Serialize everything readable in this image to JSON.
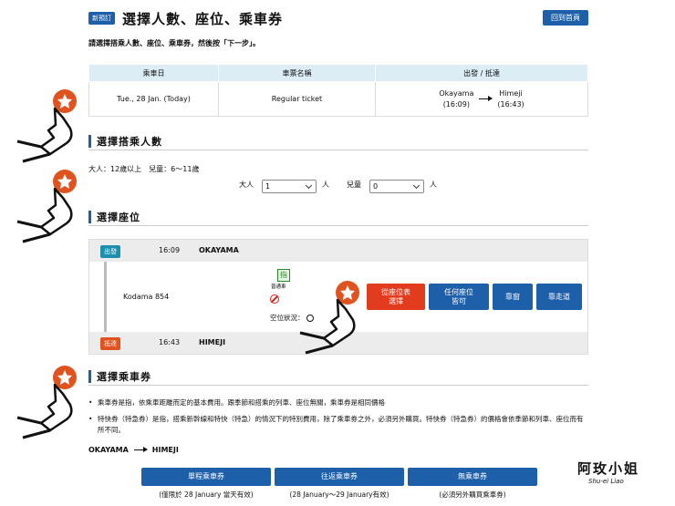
{
  "header": {
    "badge": "新預訂",
    "title": "選擇人數、座位、乘車券",
    "home_button": "回到首頁"
  },
  "instruction": "請選擇搭乘人數、座位、乘車券，然後按「下一步」。",
  "trip_table": {
    "headers": [
      "乘車日",
      "車票名稱",
      "出發 / 抵達"
    ],
    "date": "Tue., 28 Jan. (Today)",
    "ticket_name": "Regular ticket",
    "from_station": "Okayama",
    "from_time": "(16:09)",
    "to_station": "Himeji",
    "to_time": "(16:43)"
  },
  "passengers": {
    "section_title": "選擇搭乘人數",
    "note": "大人：12歲以上　兒童：6～11歲",
    "adult_label": "大人",
    "adult_value": "1",
    "child_label": "兒童",
    "child_value": "0",
    "unit": "人"
  },
  "seats": {
    "section_title": "選擇座位",
    "dep_tag": "出發",
    "dep_time": "16:09",
    "dep_station": "OKAYAMA",
    "train": "Kodama 854",
    "reserved_icon": "指",
    "car_type": "普通車",
    "vacancy_label": "空位狀況：",
    "arr_tag": "抵達",
    "arr_time": "16:43",
    "arr_station": "HIMEJI",
    "buttons": {
      "seat_map_1": "從座位表",
      "seat_map_2": "選擇",
      "any_seat_1": "任何座位",
      "any_seat_2": "皆可",
      "window": "靠窗",
      "aisle": "靠走道"
    }
  },
  "tickets": {
    "section_title": "選擇乘車券",
    "notes": [
      "乘車券是指，依乘車距離而定的基本費用。跟季節和搭乘的列車、座位無關，乘車券是相同價格",
      "特快券（特急券）是指，搭乘新幹線和特快（特急）的情況下的特別費用，除了乘車券之外，必須另外購買。特快券（特急券）的價格會依季節和列車、座位而有所不同。"
    ],
    "from": "OKAYAMA",
    "to": "HIMEJI",
    "options": [
      {
        "label": "單程乘車券",
        "note": "(僅限於 28 January 當天有效)"
      },
      {
        "label": "往返乘車券",
        "note": "(28 January～29 January有效)"
      },
      {
        "label": "無乘車券",
        "note": "(必須另外購買乘車券)"
      }
    ]
  },
  "watermark": {
    "text": "阿玫小姐",
    "sub": "Shu-ei Liao"
  }
}
